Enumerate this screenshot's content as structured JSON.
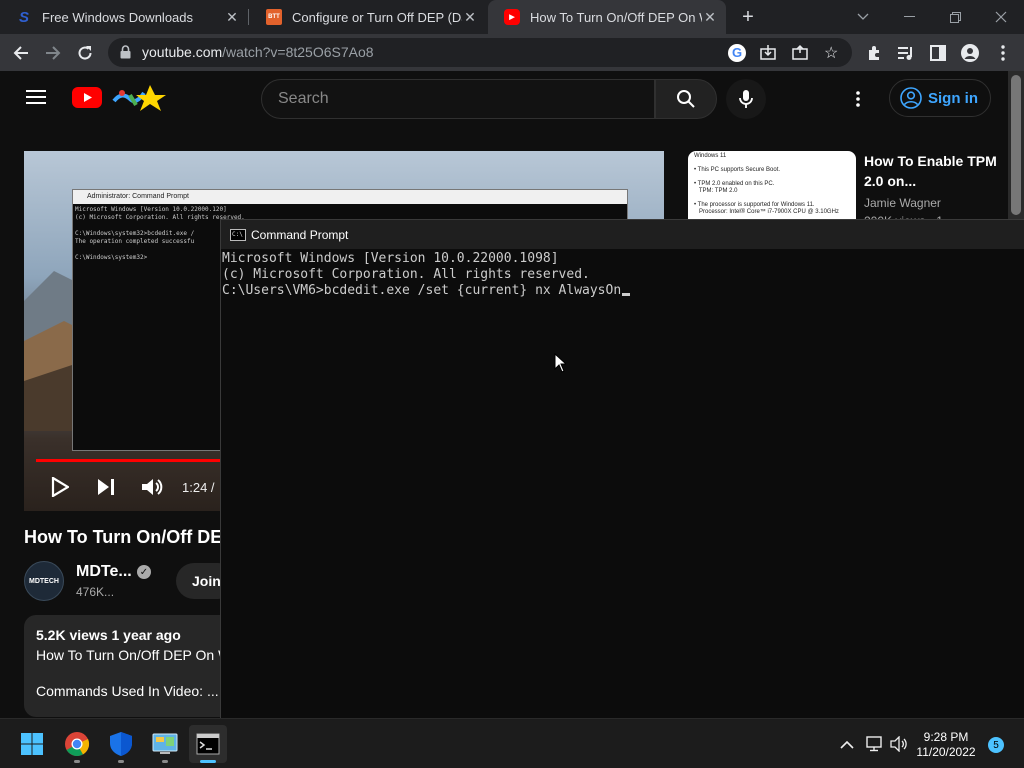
{
  "browser": {
    "tabs": [
      {
        "title": "Free Windows Downloads",
        "favicon": "S",
        "favicon_color": "#2f5fd0"
      },
      {
        "title": "Configure or Turn Off DEP (Data",
        "favicon": "BTT",
        "favicon_color": "#e2622c"
      },
      {
        "title": "How To Turn On/Off DEP On Win",
        "favicon": "▶",
        "favicon_color": "#ff0000"
      }
    ],
    "url_domain": "youtube.com",
    "url_path": "/watch?v=8t25O6S7Ao8"
  },
  "youtube": {
    "search_placeholder": "Search",
    "signin_label": "Sign in",
    "video": {
      "title": "How To Turn On/Off DE",
      "time": "1:24 /",
      "progress": 0.3,
      "inner_window_title": "Administrator: Command Prompt",
      "inner_text": "Microsoft Windows [Version 10.0.22000.120]\n(c) Microsoft Corporation. All rights reserved.\n\nC:\\Windows\\system32>bcdedit.exe /\nThe operation completed successfu\n\nC:\\Windows\\system32>"
    },
    "channel": {
      "name": "MDTe...",
      "subscribers": "476K...",
      "join_label": "Join",
      "avatar_text": "MDTECH"
    },
    "description": {
      "meta": "5.2K views  1 year ago",
      "line1": "How To Turn On/Off DEP On W",
      "line2": "Commands Used In Video:  ..."
    },
    "recommended": {
      "title": "How To Enable TPM 2.0 on...",
      "channel": "Jamie Wagner",
      "views": "200K views • 1",
      "thumb_text": "Windows 11\n\n• This PC supports Secure Boot.\n\n• TPM 2.0 enabled on this PC.\n   TPM: TPM 2.0\n\n• The processor is supported for Windows 11.\n   Processor: Intel® Core™ i7-7900X CPU @ 3.10GHz"
    }
  },
  "cmd": {
    "title": "Command Prompt",
    "lines": [
      "Microsoft Windows [Version 10.0.22000.1098]",
      "(c) Microsoft Corporation. All rights reserved.",
      "C:\\Users\\VM6>bcdedit.exe /set {current} nx AlwaysOn"
    ]
  },
  "taskbar": {
    "time": "9:28 PM",
    "date": "11/20/2022",
    "notifications": "5"
  }
}
